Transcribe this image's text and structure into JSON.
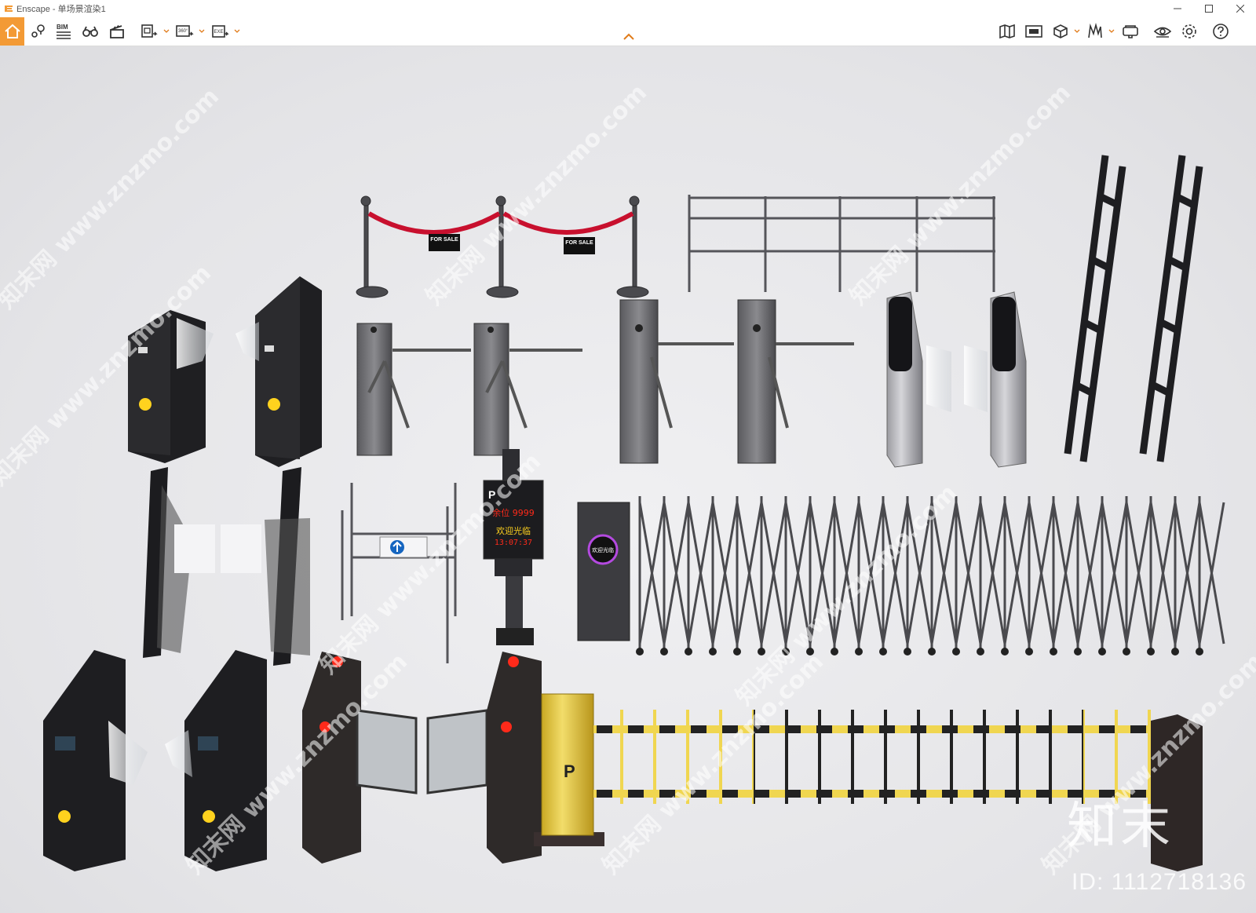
{
  "window": {
    "title": "Enscape - 单场景渲染1",
    "controls": [
      "minimize",
      "maximize",
      "close"
    ]
  },
  "toolbar": {
    "left_buttons": [
      {
        "name": "home-icon",
        "label": ""
      },
      {
        "name": "location-icon",
        "label": ""
      },
      {
        "name": "bim-icon",
        "label": "BIM"
      },
      {
        "name": "binoculars-icon",
        "label": ""
      },
      {
        "name": "clapper-icon",
        "label": ""
      },
      {
        "name": "batch-render-icon",
        "label": ""
      },
      {
        "name": "panorama-360-icon",
        "label": "360°"
      },
      {
        "name": "export-exe-icon",
        "label": "EXE"
      }
    ],
    "right_buttons": [
      "map-icon",
      "media-icon",
      "asset-box-icon",
      "material-icon",
      "vr-icon",
      "visibility-icon",
      "settings-icon",
      "help-icon"
    ]
  },
  "scene": {
    "signs": {
      "for_sale": "FOR SALE",
      "parking_remaining": "余位 9999",
      "parking_welcome": "欢迎光临",
      "parking_time": "13:07:37",
      "parking_logo": "P",
      "gate_display": "欢迎光临",
      "barrier_logo": "P"
    }
  },
  "watermark": {
    "brand": "知末",
    "id_text": "ID: 1112718136",
    "diag_text": "知末网 www.znzmo.com"
  },
  "colors": {
    "accent": "#f39a35",
    "red_rope": "#c8102e",
    "yellow_boom": "#e8c84a",
    "led_red": "#ff2a1a",
    "led_yellow": "#ffd21e"
  }
}
